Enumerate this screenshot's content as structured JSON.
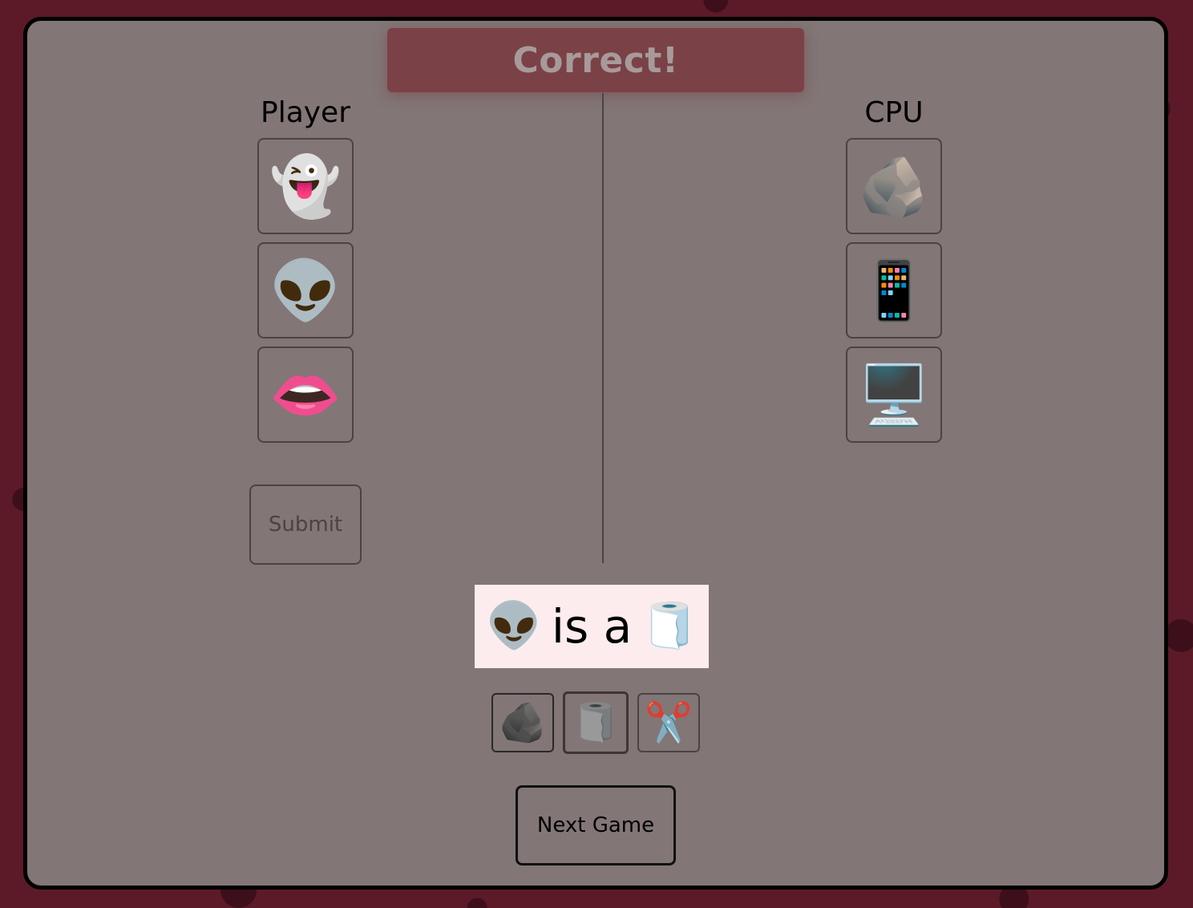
{
  "banner": {
    "text": "Correct!"
  },
  "player": {
    "heading": "Player",
    "slots": [
      "👻",
      "👽",
      "👄"
    ],
    "slot_icons": [
      "ghost-icon",
      "alien-icon",
      "lips-icon"
    ],
    "submit_label": "Submit"
  },
  "cpu": {
    "heading": "CPU",
    "slots": [
      "🪨",
      "📱",
      "🖥️"
    ],
    "slot_icons": [
      "rock-icon",
      "mobile-phone-icon",
      "desktop-computer-icon"
    ]
  },
  "result": {
    "subject": "👽",
    "text": "is a",
    "object": "🧻"
  },
  "choices": [
    {
      "emoji": "🪨",
      "icon": "rock-icon",
      "selected": false
    },
    {
      "emoji": "🧻",
      "icon": "toilet-paper-icon",
      "selected": true
    },
    {
      "emoji": "✂️",
      "icon": "scissors-icon",
      "selected": false
    }
  ],
  "next_label": "Next Game",
  "colors": {
    "panel": "#827676",
    "banner": "#7a4247",
    "banner_text": "#a89a9a",
    "result_bg": "#fdecee",
    "selected_border": "#b3434f",
    "page_bg": "#5c1a28"
  }
}
